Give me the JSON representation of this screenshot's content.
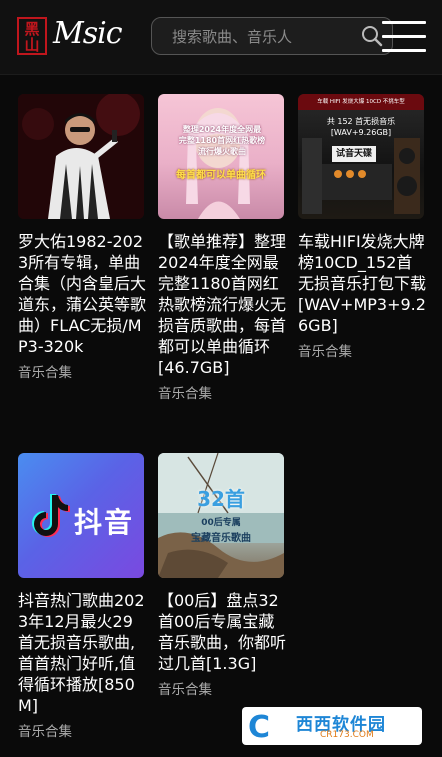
{
  "header": {
    "logo_mark": "黑山",
    "logo_text": "Msic",
    "search_placeholder": "搜索歌曲、音乐人"
  },
  "cards": [
    {
      "title": "罗大佑1982-2023所有专辑，单曲合集（内含皇后大道东，蒲公英等歌曲）FLAC无损/MP3-320k",
      "category": "音乐合集"
    },
    {
      "title": "【歌单推荐】整理2024年度全网最完整1180首网红热歌榜流行爆火无损音质歌曲，每首都可以单曲循环[46.7GB]",
      "category": "音乐合集",
      "thumb_lines": [
        "整理2024年度全网最",
        "完整1180首网红热歌榜",
        "流行爆火歌曲"
      ],
      "thumb_bottom": "每首都可以单曲循环"
    },
    {
      "title": "车载HIFI发烧大牌榜10CD_152首无损音乐打包下载[WAV+MP3+9.26GB]",
      "category": "音乐合集",
      "thumb_top": "车载 HIFI 发烧大爆 10CD 不挑车型",
      "thumb_line1": "共 152 首无损音乐",
      "thumb_line2": "[WAV+9.26GB]",
      "thumb_box": "试音天碟"
    },
    {
      "title": "抖音热门歌曲2023年12月最火29首无损音乐歌曲,首首热门好听,值得循环播放[850M]",
      "category": "音乐合集",
      "thumb_text": "抖音"
    },
    {
      "title": "【00后】盘点32首00后专属宝藏音乐歌曲，你都听过几首[1.3G]",
      "category": "音乐合集",
      "thumb_big": "32首",
      "thumb_line1": "00后专属",
      "thumb_line2": "宝藏音乐歌曲"
    }
  ],
  "watermark": {
    "main": "西西软件园",
    "domain": "CR173.COM"
  },
  "colors": {
    "accent_red": "#c0161d",
    "background": "#0a0a0a",
    "watermark_blue": "#1e86d6"
  }
}
